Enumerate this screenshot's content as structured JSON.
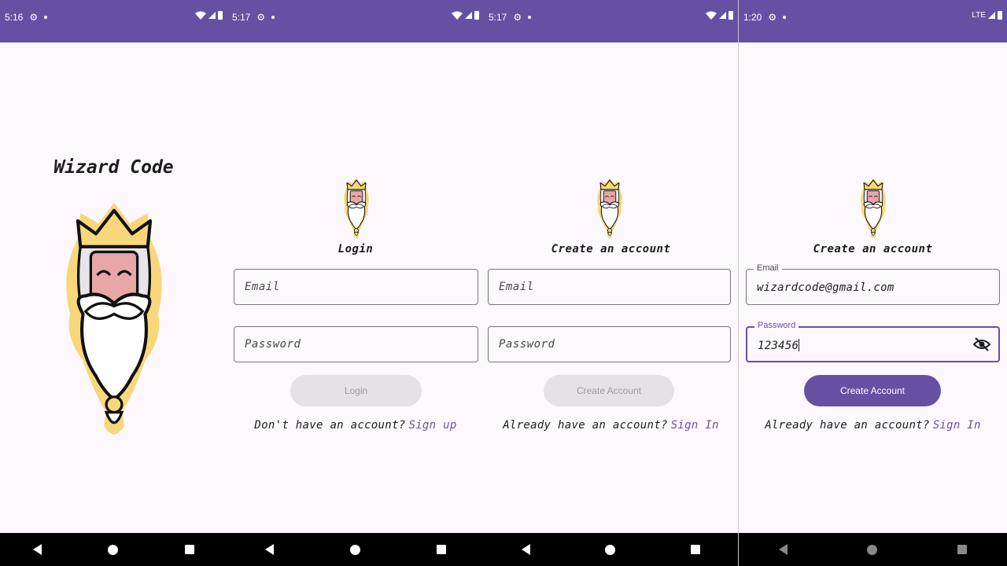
{
  "screens": [
    {
      "status_time": "5:16",
      "title": "Wizard Code"
    },
    {
      "status_time": "5:17",
      "heading": "Login",
      "email_placeholder": "Email",
      "password_placeholder": "Password",
      "button_label": "Login",
      "footer_text": "Don't have an account?",
      "footer_link": "Sign up"
    },
    {
      "status_time": "5:17",
      "heading": "Create an account",
      "email_placeholder": "Email",
      "password_placeholder": "Password",
      "button_label": "Create Account",
      "footer_text": "Already have an account?",
      "footer_link": "Sign In"
    },
    {
      "status_time": "1:20",
      "network": "LTE",
      "heading": "Create an account",
      "email_label": "Email",
      "email_value": "wizardcode@gmail.com",
      "password_label": "Password",
      "password_value": "123456",
      "button_label": "Create Account",
      "footer_text": "Already have an account?",
      "footer_link": "Sign In"
    }
  ],
  "colors": {
    "primary": "#6750a4",
    "background": "#fdf8fd",
    "disabled_button": "#e5e1e6",
    "logo_gold": "#f7d77a",
    "logo_skin": "#e8a7a7"
  },
  "icons": {
    "status": [
      "gear-icon",
      "wifi-icon",
      "signal-icon",
      "battery-icon"
    ],
    "nav": [
      "back-icon",
      "home-icon",
      "recents-icon"
    ],
    "password_toggle": "visibility-off-icon"
  }
}
